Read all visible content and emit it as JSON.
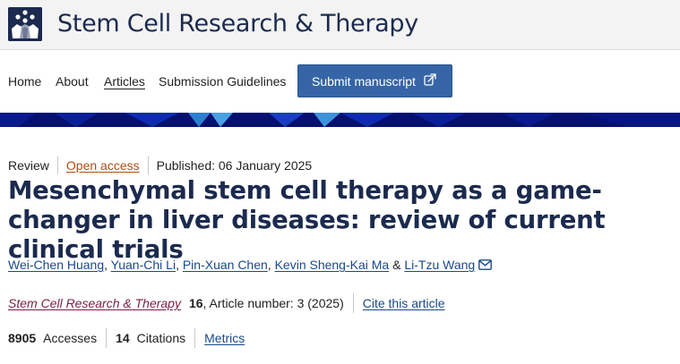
{
  "header": {
    "journal_title": "Stem Cell Research & Therapy"
  },
  "nav": {
    "items": [
      {
        "label": "Home"
      },
      {
        "label": "About"
      },
      {
        "label": "Articles"
      },
      {
        "label": "Submission Guidelines"
      }
    ],
    "active_item": "Articles",
    "submit_label": "Submit manuscript",
    "submit_icon": "external-link-icon"
  },
  "article": {
    "type": "Review",
    "access": "Open access",
    "published": "Published: 06 January 2025",
    "title": "Mesenchymal stem cell therapy as a game-changer in liver diseases: review of current clinical trials",
    "authors": [
      {
        "name": "Wei-Chen Huang",
        "after": ", "
      },
      {
        "name": "Yuan-Chi Li",
        "after": ", "
      },
      {
        "name": "Pin-Xuan Chen",
        "after": ", "
      },
      {
        "name": "Kevin Sheng-Kai Ma",
        "after": " & "
      },
      {
        "name": "Li-Tzu Wang",
        "after": ""
      }
    ],
    "corresponding_icon": "mail-icon",
    "journal": "Stem Cell Research & Therapy",
    "volume": "16",
    "article_number": ", Article number: 3 (2025)",
    "cite_label": "Cite this article",
    "accesses_count": "8905",
    "accesses_label": "Accesses",
    "citations_count": "14",
    "citations_label": "Citations",
    "metrics_label": "Metrics"
  },
  "colors": {
    "brand_navy": "#1b2a4e",
    "submit_button": "#3565a6",
    "banner": "#06106e",
    "open_access": "#b04d14",
    "link": "#1a4a8a",
    "journal_link": "#7a1f45"
  }
}
